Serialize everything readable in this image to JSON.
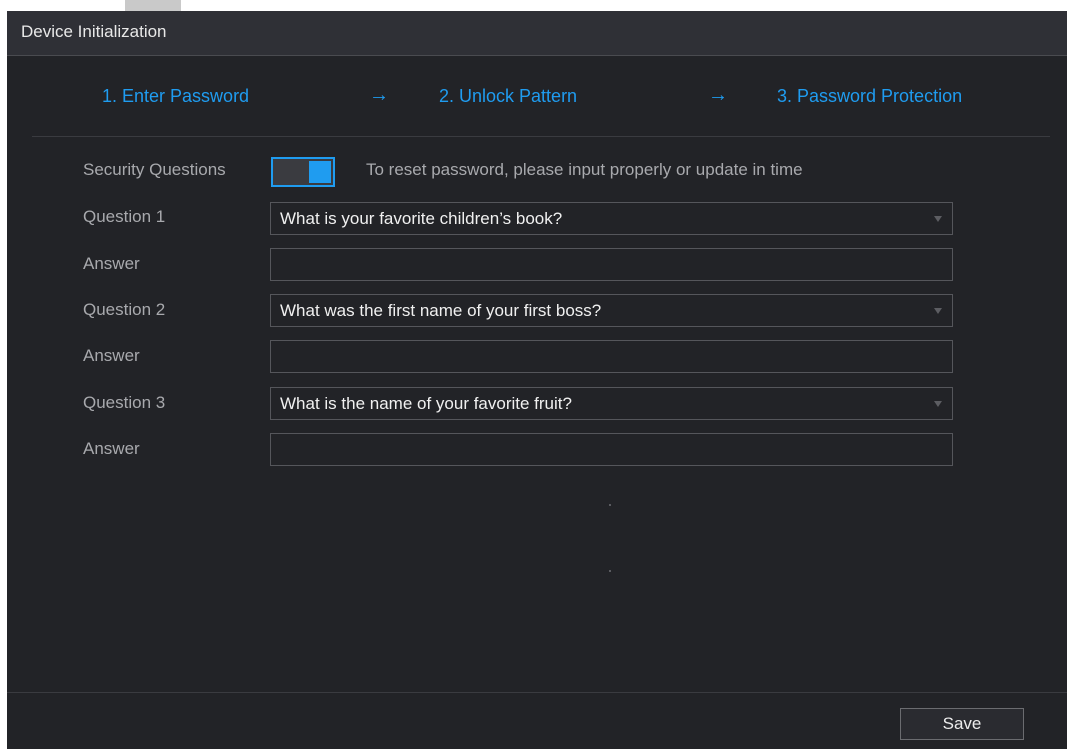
{
  "window": {
    "title": "Device Initialization"
  },
  "steps": [
    {
      "label": "1.  Enter Password"
    },
    {
      "label": "2.  Unlock Pattern"
    },
    {
      "label": "3.  Password Protection"
    }
  ],
  "step_arrow": "→",
  "security": {
    "label": "Security Questions",
    "enabled": true,
    "hint": "To reset password, please input properly or update in time"
  },
  "questions": [
    {
      "label": "Question 1",
      "value": "What is your favorite children’s book?"
    },
    {
      "label": "Question 2",
      "value": "What was the first name of your first boss?"
    },
    {
      "label": "Question 3",
      "value": "What is the name of your favorite fruit?"
    }
  ],
  "answer_label": "Answer",
  "answers": [
    "",
    "",
    ""
  ],
  "footer": {
    "save_label": "Save"
  },
  "colors": {
    "accent": "#1f9cf0",
    "background": "#222327",
    "titlebar": "#2f3036"
  }
}
